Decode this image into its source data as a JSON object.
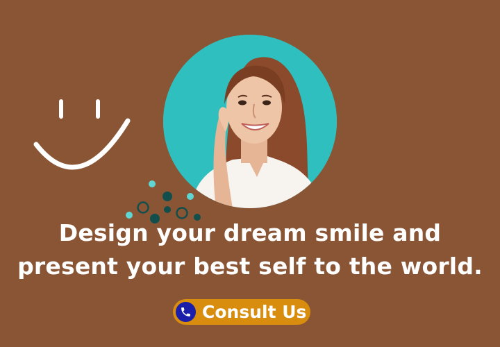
{
  "colors": {
    "background": "#8a5535",
    "photo_background": "#2fbfbe",
    "text": "#ffffff",
    "button": "#d88d0e",
    "button_icon": "#1b1ea8",
    "dot_light": "#5fd6d2",
    "dot_dark": "#124f4c"
  },
  "headline": {
    "line1": "Design your dream smile and",
    "line2": "present your best self to the world."
  },
  "cta": {
    "label": "Consult Us",
    "icon": "phone-icon"
  },
  "decorations": {
    "smiley": "smiley-face-icon",
    "photo": "smiling-woman-photo",
    "dots": "dot-cluster"
  }
}
